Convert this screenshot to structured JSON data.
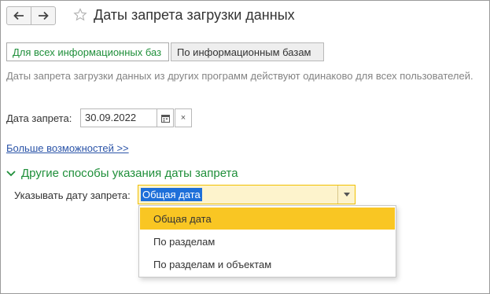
{
  "window": {
    "title": "Даты запрета загрузки данных",
    "back_icon": "arrow-left-icon",
    "forward_icon": "arrow-right-icon",
    "favorite_icon": "star-icon"
  },
  "tabs": [
    {
      "label": "Для всех информационных баз",
      "active": true
    },
    {
      "label": "По информационным базам",
      "active": false
    }
  ],
  "info_text": "Даты запрета загрузки данных из других программ действуют одинаково для всех пользователей.",
  "date": {
    "label": "Дата запрета:",
    "value": "30.09.2022",
    "calendar_icon": "calendar-icon",
    "clear_icon": "clear-icon",
    "clear_glyph": "×"
  },
  "more_link": "Больше возможностей >>",
  "section": {
    "title": "Другие способы указания даты запрета",
    "chevron_icon": "chevron-down-icon"
  },
  "specify": {
    "label": "Указывать дату запрета:",
    "selected": "Общая дата",
    "arrow_icon": "dropdown-arrow-icon",
    "options": [
      "Общая дата",
      "По разделам",
      "По разделам и объектам"
    ]
  },
  "colors": {
    "accent_green": "#1f8f3a",
    "link_blue": "#2b54a8",
    "selection_yellow": "#f9c623",
    "combo_bg": "#fdf3cc",
    "text_selection": "#1e6fd9"
  }
}
